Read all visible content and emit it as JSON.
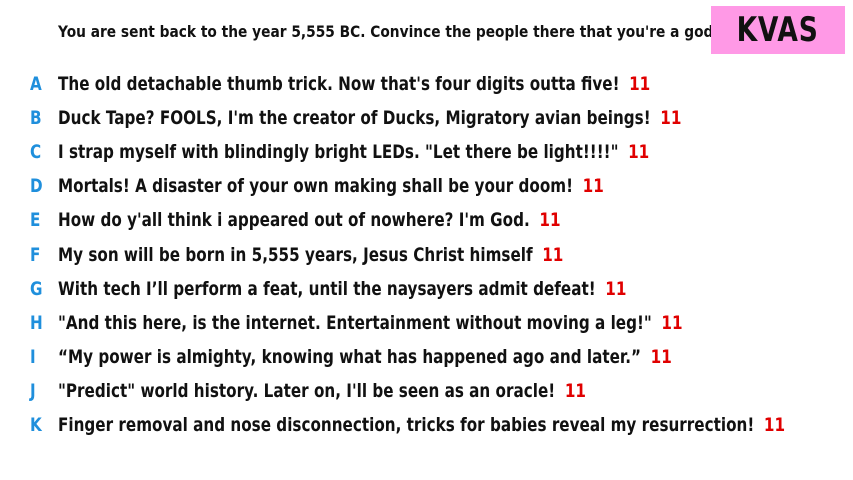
{
  "colors": {
    "badge_bg": "#ff99e6",
    "letter": "#1f8fdc",
    "score": "#e00000",
    "text": "#111111"
  },
  "prompt": "You are sent back to the year 5,555 BC. Convince the people there that you're a god.",
  "team": "KVAS",
  "answers": [
    {
      "letter": "A",
      "text": "The old detachable thumb trick. Now that's four digits outta five!",
      "score": "11"
    },
    {
      "letter": "B",
      "text": "Duck Tape? FOOLS, I'm the creator of Ducks, Migratory avian beings!",
      "score": "11"
    },
    {
      "letter": "C",
      "text": "I strap myself with blindingly bright LEDs. \"Let there be light!!!!\"",
      "score": "11"
    },
    {
      "letter": "D",
      "text": "Mortals! A disaster of your own making shall be your doom!",
      "score": "11"
    },
    {
      "letter": "E",
      "text": "How do y'all think i appeared out of nowhere? I'm God.",
      "score": "11"
    },
    {
      "letter": "F",
      "text": "My son will be born in 5,555 years, Jesus Christ himself",
      "score": "11"
    },
    {
      "letter": "G",
      "text": "With tech I’ll perform a feat, until the naysayers admit defeat!",
      "score": "11"
    },
    {
      "letter": "H",
      "text": "\"And this here, is the internet. Entertainment without moving a leg!\"",
      "score": "11"
    },
    {
      "letter": "I",
      "text": "“My power is almighty, knowing what has happened ago and later.”",
      "score": "11"
    },
    {
      "letter": "J",
      "text": "\"Predict\" world history. Later on, I'll be seen as an oracle!",
      "score": "11"
    },
    {
      "letter": "K",
      "text": "Finger removal and nose disconnection, tricks for babies reveal my resurrection!",
      "score": "11"
    }
  ]
}
